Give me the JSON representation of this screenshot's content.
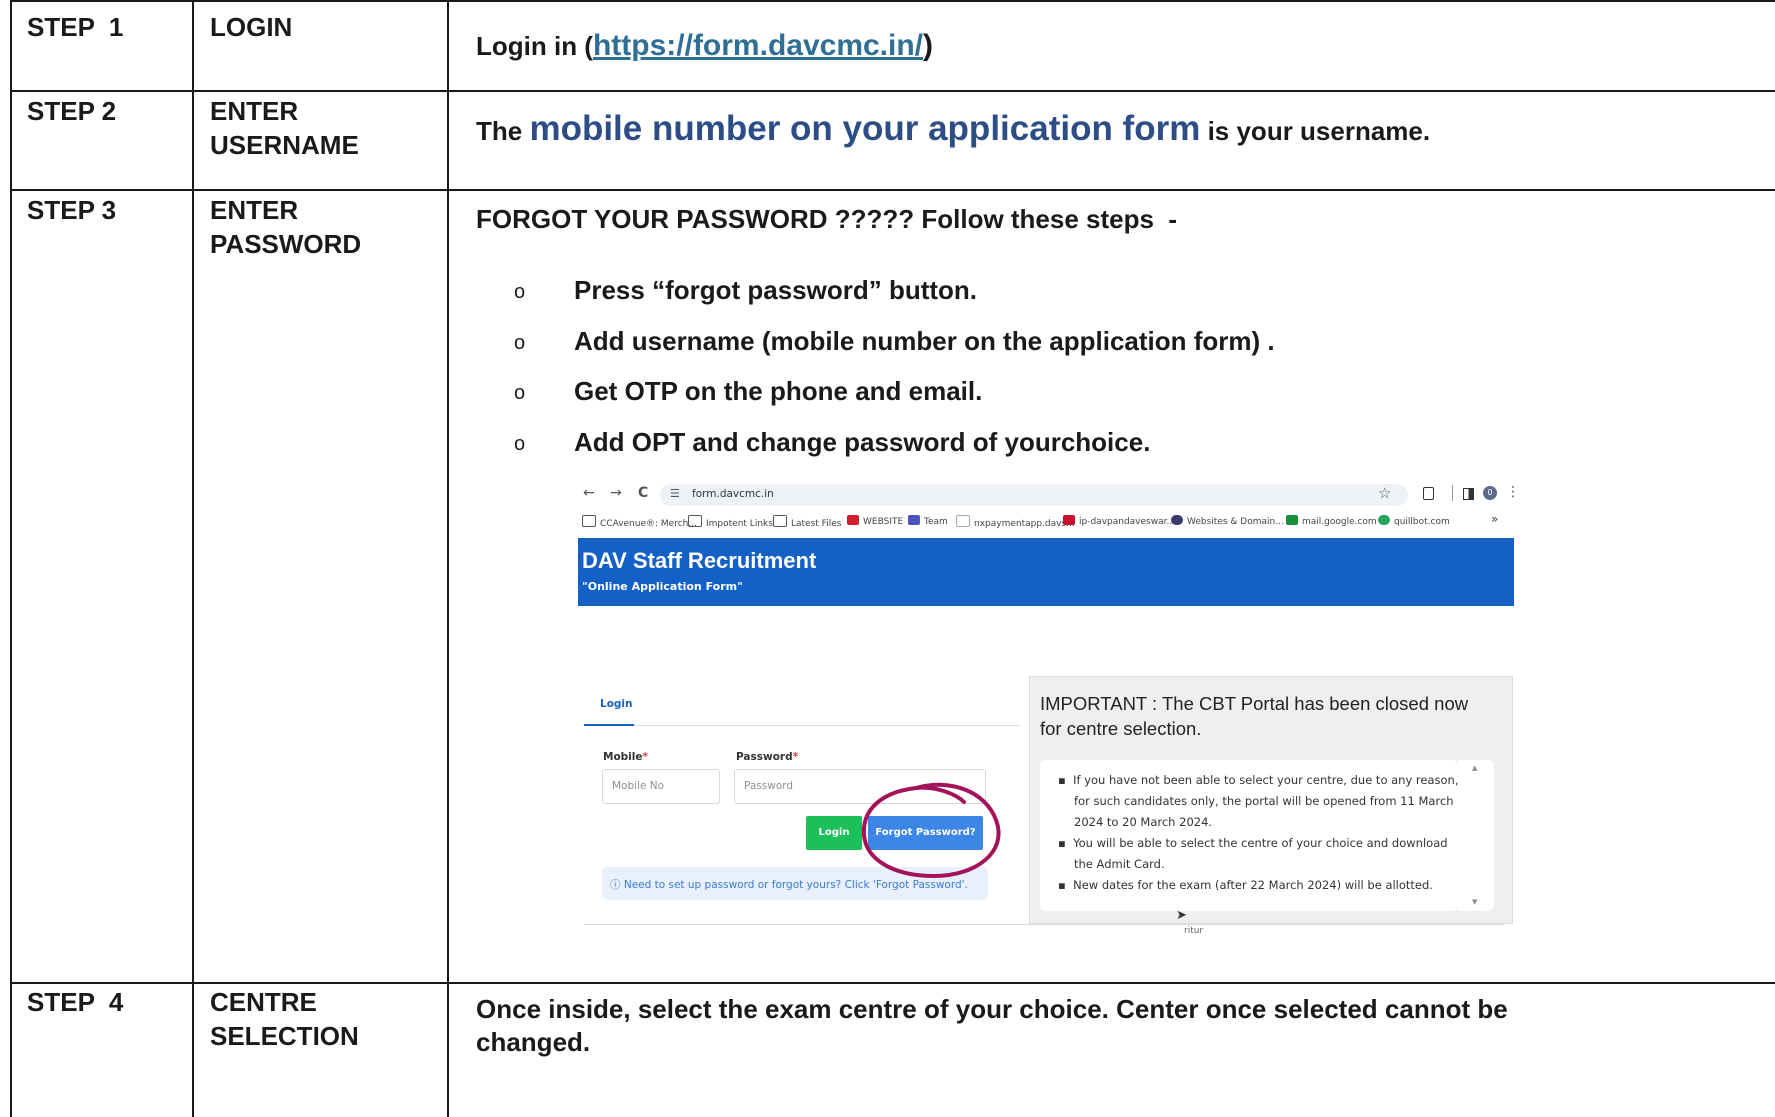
{
  "rows": [
    {
      "step": "STEP  1",
      "label1": "LOGIN",
      "label2": ""
    },
    {
      "step": "STEP 2",
      "label1": "ENTER",
      "label2": "USERNAME"
    },
    {
      "step": "STEP 3",
      "label1": "ENTER",
      "label2": "PASSWORD"
    },
    {
      "step": "STEP  4",
      "label1": "CENTRE",
      "label2": "SELECTION"
    }
  ],
  "step1": {
    "prefix": "Login in (",
    "url": "https://form.davcmc.in/",
    "suffix": ")"
  },
  "step2": {
    "prefix": "The ",
    "highlight": "mobile number on your application form",
    "suffix": " is your username."
  },
  "step3": {
    "heading": "FORGOT YOUR PASSWORD ????? Follow these steps  -",
    "bullet_mark": "o",
    "bullets": [
      "Press “forgot password” button.",
      "Add username (mobile number on the application form) .",
      "Get OTP on the phone and email.",
      "Add OPT and change password of yourchoice."
    ]
  },
  "step4": {
    "line1": "Once inside, select the exam centre of your choice. Center once selected cannot be",
    "line2": "changed."
  },
  "screenshot": {
    "nav": {
      "back": "←",
      "forward": "→",
      "reload": "C",
      "star": "☆",
      "more": "⋮",
      "avatar": "0"
    },
    "address": "form.davcmc.in",
    "bookmarks": [
      "CCAvenue®: Merch...",
      "Impotent Links",
      "Latest Files",
      "WEBSITE",
      "Team",
      "nxpaymentapp.davs...",
      "ip-davpandaveswar...",
      "Websites & Domain...",
      "mail.google.com",
      "quillbot.com"
    ],
    "bookmarks_more": "»",
    "banner_title": "DAV Staff Recruitment",
    "banner_subtitle": "\"Online Application Form\"",
    "login_tab": "Login",
    "mobile_label": "Mobile",
    "password_label": "Password",
    "required_mark": "*",
    "mobile_placeholder": "Mobile No",
    "password_placeholder": "Password",
    "login_button": "Login",
    "forgot_button": "Forgot Password?",
    "info_text": "ⓘ Need to set up password or forgot yours? Click 'Forgot Password'.",
    "important_heading": "IMPORTANT : The CBT Portal has been closed now for centre selection.",
    "important_items": [
      "If you have not been able to select your centre, due to any reason, for such candidates only, the portal will be opened from 11 March 2024 to 20 March 2024.",
      "You will be able to select the centre of your choice and download the Admit Card.",
      "New dates for the exam (after 22 March 2024) will be allotted."
    ],
    "footer_fragment": "ritur",
    "accent": "#1361c6",
    "login_green": "#1cbf5a",
    "forgot_blue": "#3d86e8",
    "circle_color": "#a3125a"
  }
}
